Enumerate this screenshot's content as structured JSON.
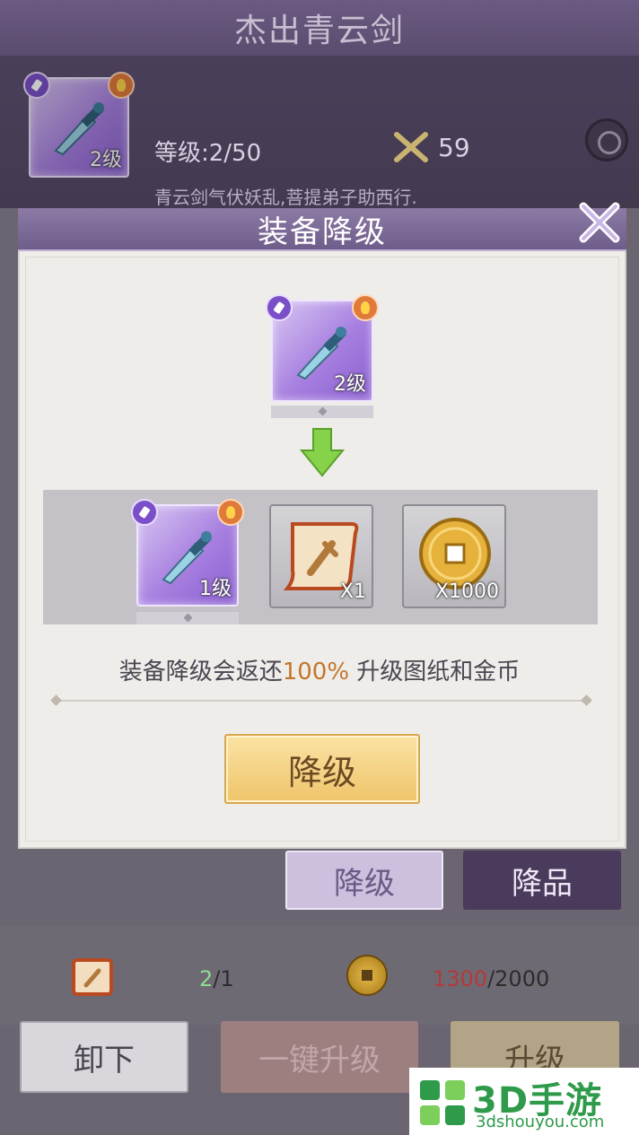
{
  "header": {
    "title": "杰出青云剑"
  },
  "item": {
    "level_text": "等级:2/50",
    "power": "59",
    "description": "青云剑气伏妖乱,菩提弟子助西行.",
    "slot_level": "2级"
  },
  "modal": {
    "title": "装备降级",
    "current_level": "2级",
    "result_level": "1级",
    "scroll_qty": "X1",
    "gold_qty": "X1000",
    "notice_prefix": "装备降级会返还",
    "notice_percent": "100%",
    "notice_suffix": " 升级图纸和金币",
    "confirm_label": "降级"
  },
  "tabs": {
    "demote": "降级",
    "quality": "降品"
  },
  "resources": {
    "scroll_have": "2",
    "scroll_need": "/1",
    "gold_have": "1300",
    "gold_need": "/2000"
  },
  "buttons": {
    "unequip": "卸下",
    "oneclick": "一键升级",
    "upgrade": "升级"
  },
  "watermark": {
    "brand": "3D手游网",
    "url": "3dshouyou.com"
  },
  "colors": {
    "accent_purple": "#8d7ba6",
    "highlight": "#c2762a",
    "confirm_gold": "#efc46a"
  }
}
